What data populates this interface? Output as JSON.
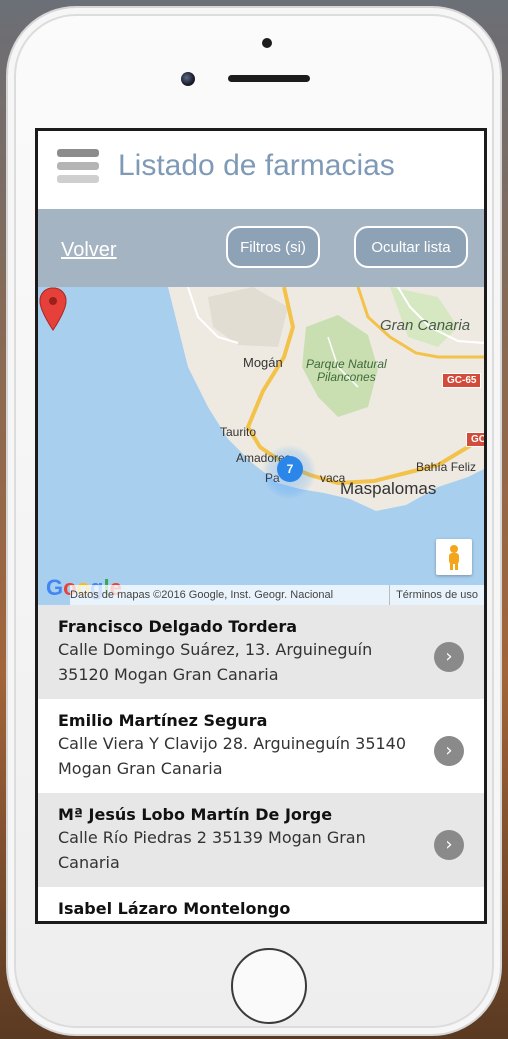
{
  "header": {
    "title": "Listado de farmacias",
    "menu_icon": "hamburger-menu-icon"
  },
  "toolbar": {
    "back_label": "Volver",
    "filters_label": "Filtros (si)",
    "hide_list_label": "Ocultar lista"
  },
  "map": {
    "labels": {
      "gran_canaria": "Gran Canaria",
      "mogan": "Mogán",
      "parque_line1": "Parque Natural",
      "parque_line2": "Pilancones",
      "taurito": "Taurito",
      "amadores": "Amadores",
      "pa": "Pa",
      "vaca": "vaca",
      "bahia_feliz": "Bahía Feliz",
      "maspalomas": "Maspalomas",
      "gc65": "GC-65",
      "gc": "GC"
    },
    "cluster_count": "7",
    "google_logo": "Google",
    "attribution": "Datos de mapas ©2016 Google, Inst. Geogr. Nacional",
    "terms": "Términos de uso",
    "colors": {
      "water": "#a9cfee",
      "land": "#eeeae2",
      "park": "#c9dfb2",
      "road": "#f3c24b",
      "pin": "#e5403a"
    }
  },
  "pharmacies": [
    {
      "name": "Francisco Delgado Tordera",
      "address": "Calle Domingo Suárez, 13. Arguineguín 35120 Mogan Gran Canaria"
    },
    {
      "name": "Emilio Martínez Segura",
      "address": "Calle Viera Y Clavijo 28. Arguineguín 35140 Mogan Gran Canaria"
    },
    {
      "name": "Mª Jesús Lobo Martín De Jorge",
      "address": "Calle Río Piedras 2 35139 Mogan Gran Canaria"
    },
    {
      "name": "Isabel Lázaro Montelongo",
      "address": ""
    }
  ],
  "chevron_glyph": "›"
}
